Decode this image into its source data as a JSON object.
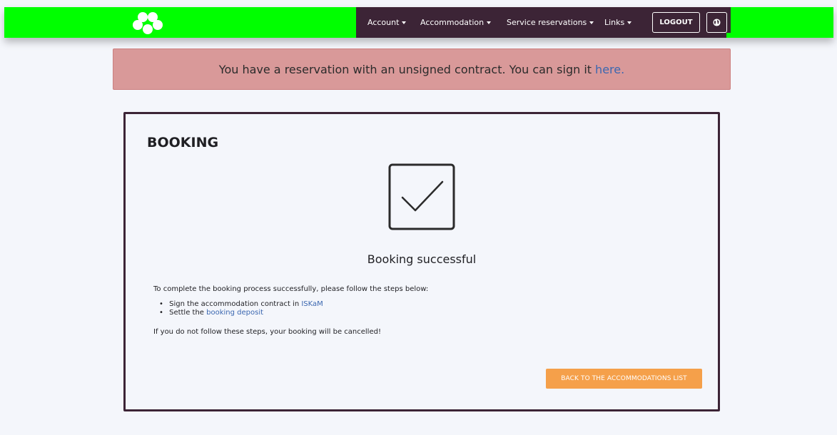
{
  "header": {
    "logo_icon": "hexagon-cluster-logo",
    "colors": {
      "bar": "#00ff00",
      "nav": "#3c2436"
    },
    "nav": {
      "account": "Account",
      "accommodation": "Accommodation",
      "service_reservations": "Service reservations",
      "links": "Links"
    },
    "logout_label": "LOGOUT",
    "language_icon": "globe-icon"
  },
  "alert": {
    "message": "You have a reservation with an unsigned contract. You can sign it",
    "link_text": "here.",
    "color": "#d99999"
  },
  "booking": {
    "title": "BOOKING",
    "status_icon": "checkmark-box-icon",
    "success_message": "Booking successful",
    "instructions": "To complete the booking process successfully, please follow the steps below:",
    "steps": [
      {
        "text": "Sign the accommodation contract in",
        "link": "ISKaM"
      },
      {
        "text": "Settle the",
        "link": "booking deposit"
      }
    ],
    "warning": "If you do not follow these steps, your booking will be cancelled!",
    "back_button": "BACK TO THE ACCOMMODATIONS LIST",
    "button_color": "#f5a04a",
    "link_color": "#3b67b0"
  }
}
